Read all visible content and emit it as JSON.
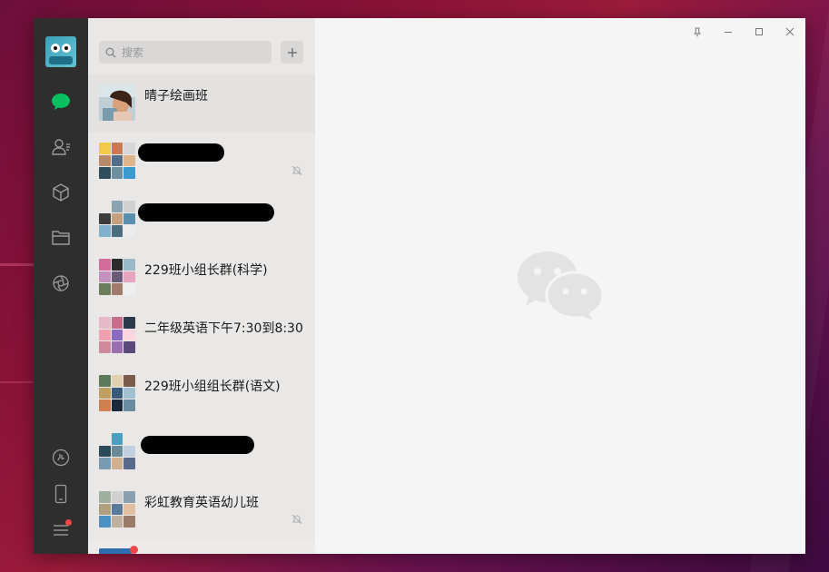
{
  "search": {
    "placeholder": "搜索"
  },
  "chats": [
    {
      "name": "晴子绘画班",
      "redacted": false,
      "muted": false
    },
    {
      "name": "",
      "redacted": true,
      "muted": true
    },
    {
      "name": "",
      "redacted": true,
      "muted": false
    },
    {
      "name": "229班小组长群(科学)",
      "redacted": false,
      "muted": false
    },
    {
      "name": "二年级英语下午7:30到8:30",
      "redacted": false,
      "muted": false
    },
    {
      "name": "229班小组组长群(语文)",
      "redacted": false,
      "muted": false
    },
    {
      "name": "",
      "redacted": true,
      "muted": false
    },
    {
      "name": "彩虹教育英语幼儿班",
      "redacted": false,
      "muted": true
    }
  ],
  "icons": {
    "nav": [
      "chat-icon",
      "contacts-icon",
      "favorites-icon",
      "files-icon",
      "moments-icon",
      "mini-program-icon",
      "phone-icon",
      "menu-icon"
    ],
    "window": [
      "pin-icon",
      "minimize-icon",
      "maximize-icon",
      "close-icon"
    ]
  },
  "colors": {
    "accent": "#07c160",
    "sidebar": "#2e2e2e",
    "list": "#e9e8e7",
    "main": "#f5f5f5",
    "badge": "#f04848"
  }
}
